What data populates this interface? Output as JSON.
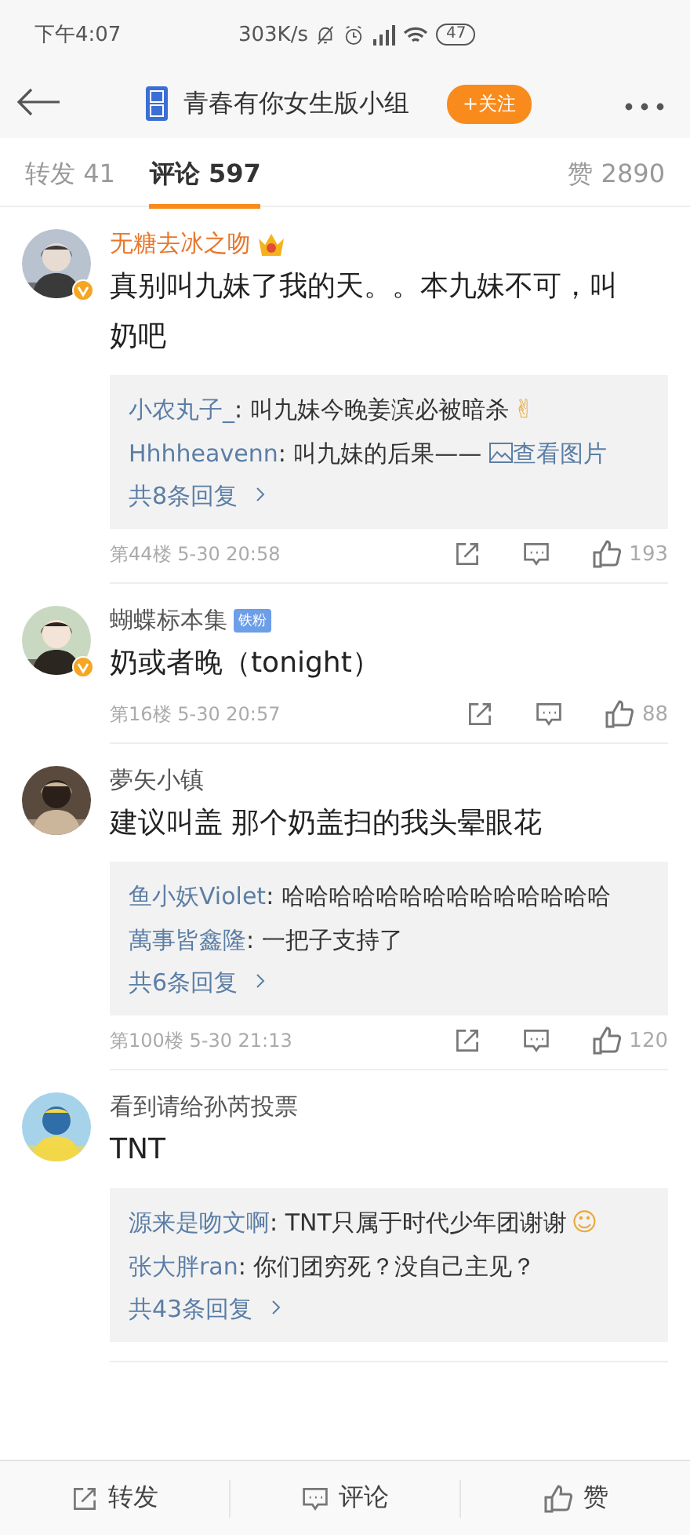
{
  "status_bar": {
    "time": "下午4:07",
    "speed": "303K/s",
    "battery": "47"
  },
  "header": {
    "group_name": "青春有你女生版小组",
    "follow_button": "+关注"
  },
  "tabs": [
    {
      "label": "转发 41",
      "selected": false
    },
    {
      "label": "评论 597",
      "selected": true
    },
    {
      "label": "赞 2890",
      "selected": false
    }
  ],
  "comments": [
    {
      "user": "无糖去冰之吻",
      "vip": true,
      "crown": true,
      "verified": true,
      "text": "真别叫九妹了我的天。。本九妹不可，叫奶吧",
      "replies": [
        {
          "user": "小农丸子_",
          "text": ": 叫九妹今晚姜滨必被暗杀",
          "emoji": "✌"
        },
        {
          "user": "Hhhheavenn",
          "text": ": 叫九妹的后果——",
          "link": "查看图片"
        }
      ],
      "more": "共8条回复",
      "floor": "第44楼",
      "time": "5-30 20:58",
      "likes": "193"
    },
    {
      "user": "蝴蝶标本集",
      "vip": false,
      "badge": "铁粉",
      "verified": true,
      "text": "奶或者晚（tonight）",
      "floor": "第16楼",
      "time": "5-30 20:57",
      "likes": "88"
    },
    {
      "user": "夢矢小镇",
      "vip": false,
      "verified": false,
      "text": "建议叫盖  那个奶盖扫的我头晕眼花",
      "replies": [
        {
          "user": "鱼小妖Violet",
          "text": ": 哈哈哈哈哈哈哈哈哈哈哈哈哈哈"
        },
        {
          "user": "萬事皆鑫隆",
          "text": ": 一把子支持了"
        }
      ],
      "more": "共6条回复",
      "floor": "第100楼",
      "time": "5-30 21:13",
      "likes": "120"
    },
    {
      "user": "看到请给孙芮投票",
      "vip": false,
      "verified": false,
      "text": "TNT",
      "replies": [
        {
          "user": "源来是吻文啊",
          "text": ": TNT只属于时代少年团谢谢",
          "emoji": "☺"
        },
        {
          "user": "张大胖ran",
          "text": ": 你们团穷死？没自己主见？"
        }
      ],
      "more": "共43条回复"
    }
  ],
  "bottom_bar": [
    "转发",
    "评论",
    "赞"
  ]
}
